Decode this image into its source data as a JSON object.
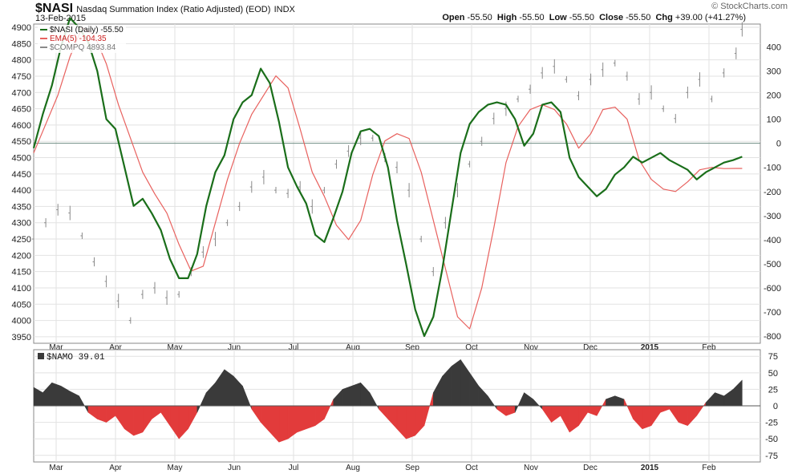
{
  "header": {
    "symbol": "$NASI",
    "title": "Nasdaq Summation Index (Ratio Adjusted) (EOD)",
    "exchange": "INDX",
    "date": "13-Feb-2015",
    "open_label": "Open",
    "open": "-55.50",
    "high_label": "High",
    "high": "-55.50",
    "low_label": "Low",
    "low": "-55.50",
    "close_label": "Close",
    "close": "-55.50",
    "chg_label": "Chg",
    "chg": "+39.00 (+41.27%)",
    "logo": "© StockCharts.com"
  },
  "legend": {
    "nasi": "$NASI (Daily) -55.50",
    "ema": "EMA(5) -104.35",
    "compq": "$COMPQ 4893.84"
  },
  "lower_legend": "$NAMO 39.01",
  "colors": {
    "nasi": "#1a6e1a",
    "ema": "#e8615e",
    "compq": "#8a8a8a",
    "namo_pos": "#3a3a3a",
    "namo_neg": "#e23b3b",
    "grid": "#e2e2e2",
    "zero": "#6e8c82"
  },
  "chart_data": [
    {
      "type": "line",
      "title": "Nasdaq Summation Index (Ratio Adjusted)",
      "x_axis": [
        "Mar",
        "Apr",
        "May",
        "Jun",
        "Jul",
        "Aug",
        "Sep",
        "Oct",
        "Nov",
        "Dec",
        "2015",
        "Feb"
      ],
      "y_left_ticks": [
        3950,
        4000,
        4050,
        4100,
        4150,
        4200,
        4250,
        4300,
        4350,
        4400,
        4450,
        4500,
        4550,
        4600,
        4650,
        4700,
        4750,
        4800,
        4850,
        4900
      ],
      "y_right_ticks": [
        400,
        300,
        200,
        100,
        0,
        -100,
        -200,
        -300,
        -400,
        -500,
        -600,
        -700,
        -800
      ],
      "ylim_left": [
        3930,
        4910
      ],
      "ylim_right": [
        -830,
        495
      ],
      "grid": true,
      "legend_position": "top-left",
      "series": [
        {
          "name": "$NASI (Daily)",
          "axis": "right",
          "last": -55.5,
          "x": [
            0,
            3,
            6,
            9,
            12,
            15,
            18,
            21,
            24,
            27,
            30,
            33,
            36,
            39,
            42,
            45,
            48,
            51,
            54,
            57,
            60,
            63,
            66,
            69,
            72,
            75,
            78,
            81,
            84,
            87,
            90,
            93,
            96,
            99,
            102,
            105,
            108,
            111,
            114,
            117,
            120,
            123,
            126,
            129,
            132,
            135,
            138,
            141,
            144,
            147,
            150,
            153,
            156,
            159,
            162,
            165,
            168,
            171,
            174,
            177,
            180,
            183,
            186,
            189,
            192,
            195,
            198,
            201,
            204,
            207,
            210,
            213,
            216,
            219,
            222,
            225,
            228,
            231,
            234
          ],
          "values": [
            -20,
            120,
            240,
            400,
            520,
            480,
            420,
            300,
            100,
            60,
            -100,
            -260,
            -230,
            -290,
            -360,
            -480,
            -560,
            -560,
            -460,
            -260,
            -120,
            -50,
            100,
            170,
            200,
            310,
            250,
            90,
            -100,
            -180,
            -250,
            -380,
            -410,
            -310,
            -200,
            -40,
            50,
            60,
            30,
            -100,
            -320,
            -500,
            -690,
            -800,
            -720,
            -520,
            -280,
            -40,
            80,
            130,
            160,
            170,
            160,
            100,
            -10,
            40,
            160,
            170,
            130,
            -60,
            -140,
            -180,
            -220,
            -190,
            -130,
            -100,
            -55.5,
            -80,
            -60,
            -40,
            -70,
            -90,
            -110,
            -150,
            -120,
            -100,
            -80,
            -70,
            -55.5
          ]
        },
        {
          "name": "EMA(5)",
          "axis": "right",
          "last": -104.35,
          "x": [
            0,
            4,
            8,
            12,
            16,
            20,
            24,
            28,
            32,
            36,
            40,
            44,
            48,
            52,
            56,
            60,
            64,
            68,
            72,
            76,
            80,
            84,
            88,
            92,
            96,
            100,
            104,
            108,
            112,
            116,
            120,
            124,
            128,
            132,
            136,
            140,
            144,
            148,
            152,
            156,
            160,
            164,
            168,
            172,
            176,
            180,
            184,
            188,
            192,
            196,
            200,
            204,
            208,
            212,
            216,
            220,
            224,
            228,
            232,
            234
          ],
          "values": [
            -40,
            80,
            200,
            360,
            480,
            450,
            330,
            160,
            20,
            -120,
            -210,
            -290,
            -420,
            -530,
            -510,
            -330,
            -150,
            0,
            120,
            200,
            280,
            230,
            60,
            -120,
            -220,
            -340,
            -400,
            -320,
            -130,
            10,
            40,
            20,
            -120,
            -320,
            -520,
            -720,
            -770,
            -600,
            -350,
            -80,
            70,
            140,
            160,
            140,
            80,
            -20,
            40,
            140,
            150,
            100,
            -70,
            -150,
            -190,
            -200,
            -160,
            -110,
            -100,
            -105,
            -104.35,
            -104.35
          ]
        },
        {
          "name": "$COMPQ",
          "axis": "left",
          "type": "ohlc",
          "last": 4893.84,
          "x": [
            0,
            4,
            8,
            12,
            16,
            20,
            24,
            28,
            32,
            36,
            40,
            44,
            48,
            52,
            56,
            60,
            64,
            68,
            72,
            76,
            80,
            84,
            88,
            92,
            96,
            100,
            104,
            108,
            112,
            116,
            120,
            124,
            128,
            132,
            136,
            140,
            144,
            148,
            152,
            156,
            160,
            164,
            168,
            172,
            176,
            180,
            184,
            188,
            192,
            196,
            200,
            204,
            208,
            212,
            216,
            220,
            224,
            228,
            232,
            234
          ],
          "values": [
            4250,
            4300,
            4340,
            4330,
            4260,
            4180,
            4120,
            4060,
            4000,
            4080,
            4100,
            4070,
            4080,
            4150,
            4210,
            4250,
            4300,
            4350,
            4410,
            4440,
            4400,
            4390,
            4410,
            4350,
            4400,
            4480,
            4520,
            4560,
            4560,
            4500,
            4470,
            4400,
            4250,
            4150,
            4300,
            4400,
            4480,
            4550,
            4620,
            4650,
            4680,
            4710,
            4760,
            4780,
            4740,
            4690,
            4740,
            4770,
            4790,
            4750,
            4680,
            4700,
            4650,
            4620,
            4700,
            4740,
            4680,
            4760,
            4820,
            4893.84
          ]
        }
      ]
    },
    {
      "type": "area",
      "title": "$NAMO",
      "x_axis": [
        "Mar",
        "Apr",
        "May",
        "Jun",
        "Jul",
        "Aug",
        "Sep",
        "Oct",
        "Nov",
        "Dec",
        "2015",
        "Feb"
      ],
      "y_ticks": [
        75,
        50,
        25,
        0,
        -25,
        -50,
        -75
      ],
      "ylim": [
        -85,
        85
      ],
      "last": 39.01,
      "x": [
        0,
        3,
        6,
        9,
        12,
        15,
        18,
        21,
        24,
        27,
        30,
        33,
        36,
        39,
        42,
        45,
        48,
        51,
        54,
        57,
        60,
        63,
        66,
        69,
        72,
        75,
        78,
        81,
        84,
        87,
        90,
        93,
        96,
        99,
        102,
        105,
        108,
        111,
        114,
        117,
        120,
        123,
        126,
        129,
        132,
        135,
        138,
        141,
        144,
        147,
        150,
        153,
        156,
        159,
        162,
        165,
        168,
        171,
        174,
        177,
        180,
        183,
        186,
        189,
        192,
        195,
        198,
        201,
        204,
        207,
        210,
        213,
        216,
        219,
        222,
        225,
        228,
        231,
        234
      ],
      "values": [
        28,
        20,
        35,
        30,
        22,
        15,
        -10,
        -20,
        -25,
        -15,
        -35,
        -45,
        -40,
        -20,
        -10,
        -30,
        -50,
        -35,
        -10,
        20,
        35,
        55,
        45,
        30,
        -5,
        -25,
        -40,
        -55,
        -50,
        -40,
        -35,
        -30,
        -20,
        10,
        25,
        30,
        35,
        20,
        -5,
        -20,
        -35,
        -50,
        -45,
        -30,
        20,
        45,
        60,
        70,
        50,
        30,
        15,
        -5,
        -15,
        -10,
        20,
        10,
        -5,
        -25,
        -15,
        -40,
        -30,
        -10,
        -15,
        10,
        15,
        10,
        -20,
        -35,
        -30,
        -10,
        -5,
        -25,
        -30,
        -15,
        5,
        20,
        15,
        25,
        39.01
      ]
    }
  ]
}
